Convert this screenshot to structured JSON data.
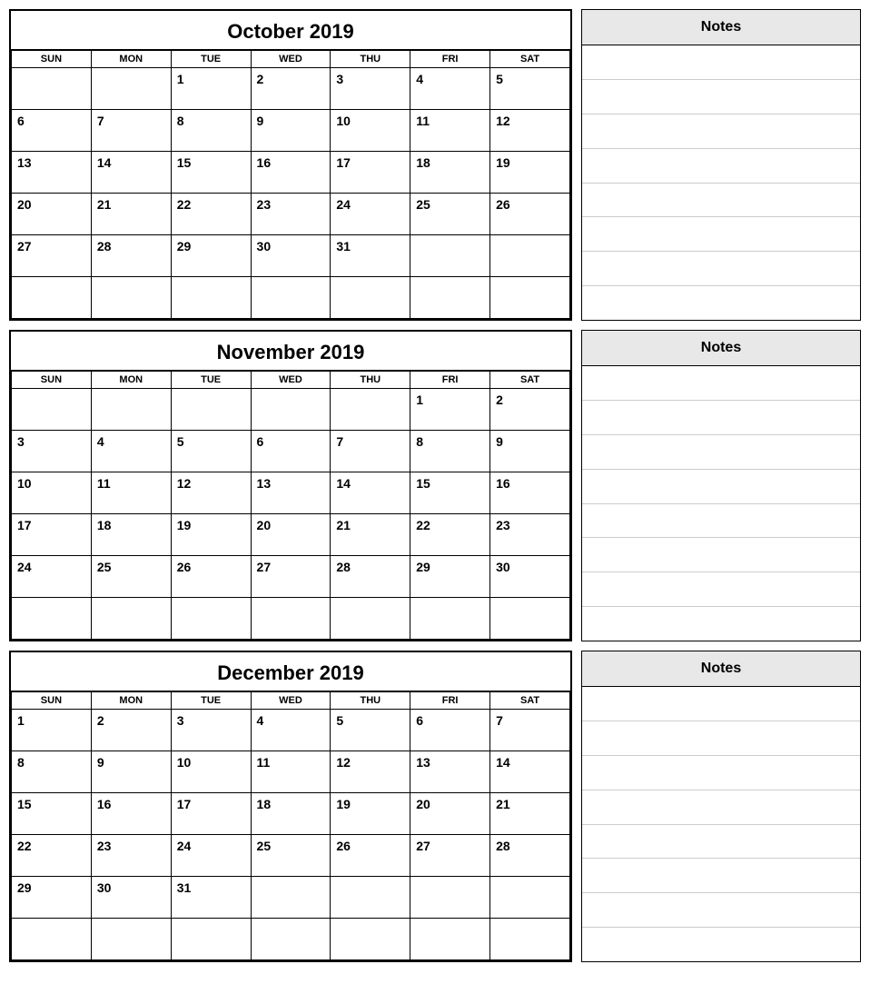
{
  "months": [
    {
      "title": "October 2019",
      "days_header": [
        "SUN",
        "MON",
        "TUE",
        "WED",
        "THU",
        "FRI",
        "SAT"
      ],
      "weeks": [
        [
          "",
          "",
          "1",
          "2",
          "3",
          "4",
          "5"
        ],
        [
          "6",
          "7",
          "8",
          "9",
          "10",
          "11",
          "12"
        ],
        [
          "13",
          "14",
          "15",
          "16",
          "17",
          "18",
          "19"
        ],
        [
          "20",
          "21",
          "22",
          "23",
          "24",
          "25",
          "26"
        ],
        [
          "27",
          "28",
          "29",
          "30",
          "31",
          "",
          ""
        ],
        [
          "",
          "",
          "",
          "",
          "",
          "",
          ""
        ]
      ],
      "notes_label": "Notes",
      "notes_lines": 8
    },
    {
      "title": "November 2019",
      "days_header": [
        "SUN",
        "MON",
        "TUE",
        "WED",
        "THU",
        "FRI",
        "SAT"
      ],
      "weeks": [
        [
          "",
          "",
          "",
          "",
          "",
          "1",
          "2"
        ],
        [
          "3",
          "4",
          "5",
          "6",
          "7",
          "8",
          "9"
        ],
        [
          "10",
          "11",
          "12",
          "13",
          "14",
          "15",
          "16"
        ],
        [
          "17",
          "18",
          "19",
          "20",
          "21",
          "22",
          "23"
        ],
        [
          "24",
          "25",
          "26",
          "27",
          "28",
          "29",
          "30"
        ],
        [
          "",
          "",
          "",
          "",
          "",
          "",
          ""
        ]
      ],
      "notes_label": "Notes",
      "notes_lines": 8
    },
    {
      "title": "December 2019",
      "days_header": [
        "SUN",
        "MON",
        "TUE",
        "WED",
        "THU",
        "FRI",
        "SAT"
      ],
      "weeks": [
        [
          "1",
          "2",
          "3",
          "4",
          "5",
          "6",
          "7"
        ],
        [
          "8",
          "9",
          "10",
          "11",
          "12",
          "13",
          "14"
        ],
        [
          "15",
          "16",
          "17",
          "18",
          "19",
          "20",
          "21"
        ],
        [
          "22",
          "23",
          "24",
          "25",
          "26",
          "27",
          "28"
        ],
        [
          "29",
          "30",
          "31",
          "",
          "",
          "",
          ""
        ],
        [
          "",
          "",
          "",
          "",
          "",
          "",
          ""
        ]
      ],
      "notes_label": "Notes",
      "notes_lines": 8
    }
  ]
}
